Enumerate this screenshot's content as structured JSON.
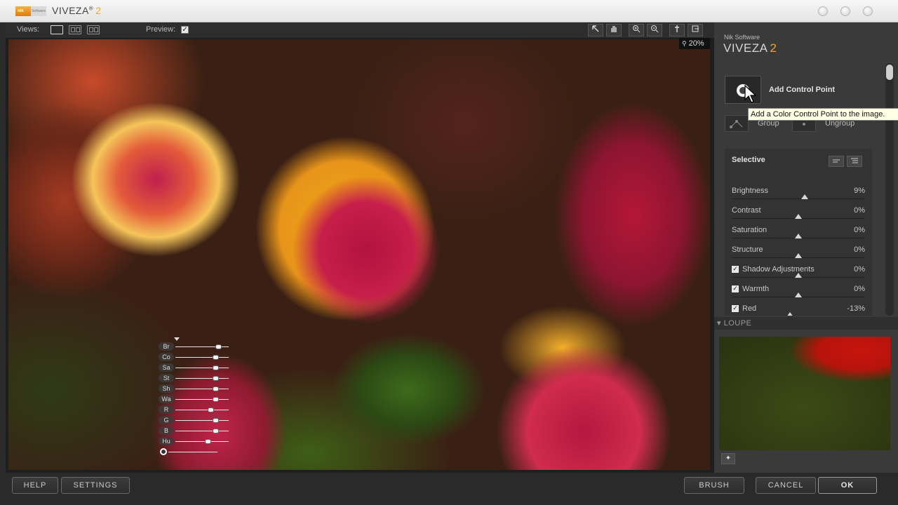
{
  "window": {
    "title": "VIVEZA",
    "title_sup": "®",
    "version": "2",
    "logo_text": "nik",
    "logo_sub": "Software"
  },
  "toolbar": {
    "views_label": "Views:",
    "preview_label": "Preview:",
    "preview_checked": "✓",
    "zoom_level": "20%",
    "tools": [
      "select-icon",
      "hand-icon",
      "zoom-in-icon",
      "zoom-out-icon",
      "eyedropper-icon",
      "export-icon"
    ]
  },
  "control_point": {
    "labels": [
      "Br",
      "Co",
      "Sa",
      "St",
      "Sh",
      "Wa",
      "R",
      "G",
      "B",
      "Hu"
    ],
    "levels": [
      0.8,
      0.75,
      0.75,
      0.75,
      0.75,
      0.75,
      0.66,
      0.75,
      0.75,
      0.6
    ]
  },
  "panel": {
    "brand_small": "Nik Software",
    "brand_big": "VIVEZA",
    "brand_version": "2",
    "add_cp_label": "Add Control Point",
    "tooltip": "Add a Color Control Point to the image.",
    "group_label": "Group",
    "ungroup_label": "Ungroup",
    "selective_title": "Selective",
    "adjustments": [
      {
        "label": "Brightness",
        "value": "9%",
        "checkbox": false
      },
      {
        "label": "Contrast",
        "value": "0%",
        "checkbox": false
      },
      {
        "label": "Saturation",
        "value": "0%",
        "checkbox": false
      },
      {
        "label": "Structure",
        "value": "0%",
        "checkbox": false
      },
      {
        "label": "Shadow Adjustments",
        "value": "0%",
        "checkbox": true
      },
      {
        "label": "Warmth",
        "value": "0%",
        "checkbox": true
      },
      {
        "label": "Red",
        "value": "-13%",
        "checkbox": true
      }
    ],
    "loupe_label": "▾ LOUPE"
  },
  "bottom": {
    "help": "HELP",
    "settings": "SETTINGS",
    "brush": "BRUSH",
    "cancel": "CANCEL",
    "ok": "OK"
  },
  "colors": {
    "accent": "#f0a530",
    "panel_bg": "#3a3a3a",
    "canvas_bg": "#1e1e1e"
  }
}
